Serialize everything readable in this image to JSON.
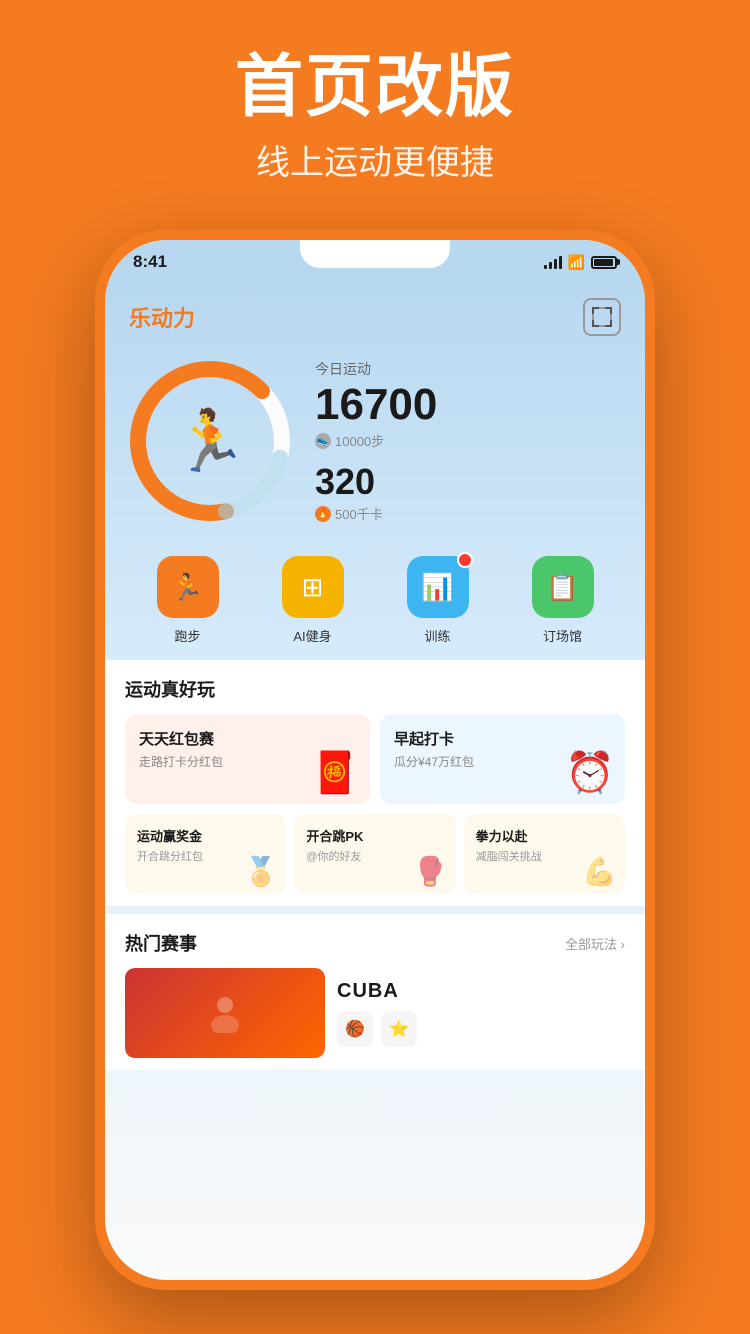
{
  "header": {
    "title": "首页改版",
    "subtitle": "线上运动更便捷"
  },
  "statusBar": {
    "time": "8:41"
  },
  "appHeader": {
    "logo": "乐动力",
    "scan_label": "scan"
  },
  "stats": {
    "label": "今日运动",
    "steps": "16700",
    "stepsGoal": "10000步",
    "calories": "320",
    "caloriesGoal": "500千卡"
  },
  "actions": [
    {
      "label": "跑步",
      "color": "orange"
    },
    {
      "label": "AI健身",
      "color": "yellow"
    },
    {
      "label": "训练",
      "color": "blue",
      "badge": true
    },
    {
      "label": "订场馆",
      "color": "green"
    }
  ],
  "funSection": {
    "title": "运动真好玩",
    "cards": [
      {
        "title": "天天红包赛",
        "desc": "走路打卡分红包",
        "bg": "red-bg"
      },
      {
        "title": "早起打卡",
        "desc": "瓜分¥47万红包",
        "bg": "blue-bg"
      }
    ],
    "smallCards": [
      {
        "title": "运动赢奖金",
        "desc": "开合跳分红包"
      },
      {
        "title": "开合跳PK",
        "desc": "@你的好友"
      },
      {
        "title": "拳力以赴",
        "desc": "减脂闯关挑战"
      }
    ]
  },
  "hotSection": {
    "title": "热门赛事",
    "moreLabel": "全部玩法 ›",
    "eventName": "CUBA"
  },
  "colors": {
    "orange": "#F47B20",
    "background": "#F47B20"
  }
}
